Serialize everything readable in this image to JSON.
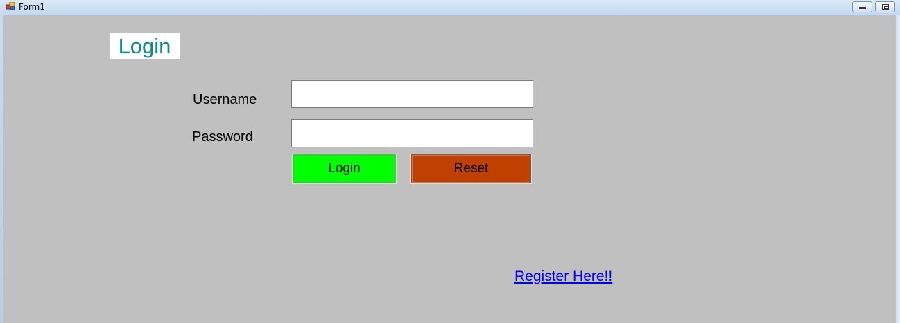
{
  "window": {
    "title": "Form1",
    "app_icon": "winforms-app-icon",
    "minimize_icon": "minimize-icon",
    "restore_icon": "restore-icon"
  },
  "form": {
    "heading": "Login",
    "username_label": "Username",
    "password_label": "Password",
    "username_value": "",
    "password_value": "",
    "login_button": "Login",
    "reset_button": "Reset",
    "register_link": "Register Here!!"
  },
  "colors": {
    "background": "#c0c0c0",
    "heading_text": "#0b8b8b",
    "login_button": "#00ff00",
    "reset_button": "#bf4000",
    "link": "#0000ff"
  }
}
